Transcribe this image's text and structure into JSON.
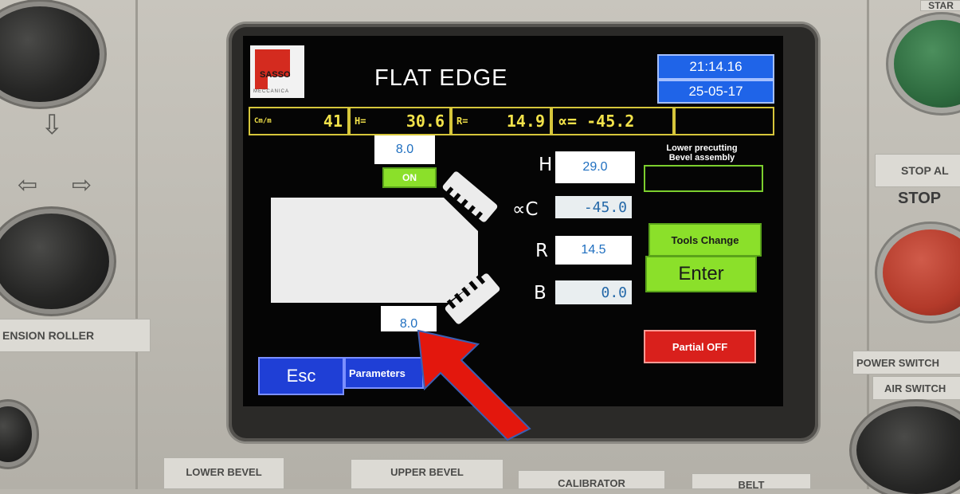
{
  "screen": {
    "brand": "SASSO",
    "brand_sub": "MECCANICA",
    "title": "FLAT EDGE",
    "time": "21:14.16",
    "date": "25-05-17",
    "status_bar": {
      "cm_label": "Cm/m",
      "cm_value": "41",
      "h_label": "H=",
      "h_value": "30.6",
      "r_label": "R=",
      "r_value": "14.9",
      "alpha_text": "∝= -45.2"
    },
    "top_offset": "8.0",
    "bottom_offset": "8.0",
    "on_label": "ON",
    "params": {
      "h_label": "H",
      "h_value": "29.0",
      "c_label": "∝C",
      "c_value": "-45.0",
      "r_label": "R",
      "r_value": "14.5",
      "b_label": "B",
      "b_value": "0.0"
    },
    "lower_precutting_label": "Lower precutting\nBevel assembly",
    "tools_change_label": "Tools Change",
    "enter_label": "Enter",
    "partial_off_label": "Partial OFF",
    "esc_label": "Esc",
    "parameters_label": "Parameters"
  },
  "panel": {
    "tension_roller": "ENSION ROLLER",
    "lower_bevel": "LOWER BEVEL",
    "upper_bevel": "UPPER BEVEL",
    "calibrator": "CALIBRATOR",
    "belt": "BELT",
    "stop_all": "STOP AL",
    "stop": "STOP",
    "power_switch": "POWER SWITCH",
    "air_switch": "AIR SWITCH",
    "top_right_partial": "STAR"
  },
  "colors": {
    "screen_bg": "#050505",
    "accent_yellow": "#f2e24a",
    "clock_blue": "#1f64e8",
    "button_green": "#8be02a",
    "button_red": "#d9201c",
    "annotation_arrow": "#e3170d"
  }
}
